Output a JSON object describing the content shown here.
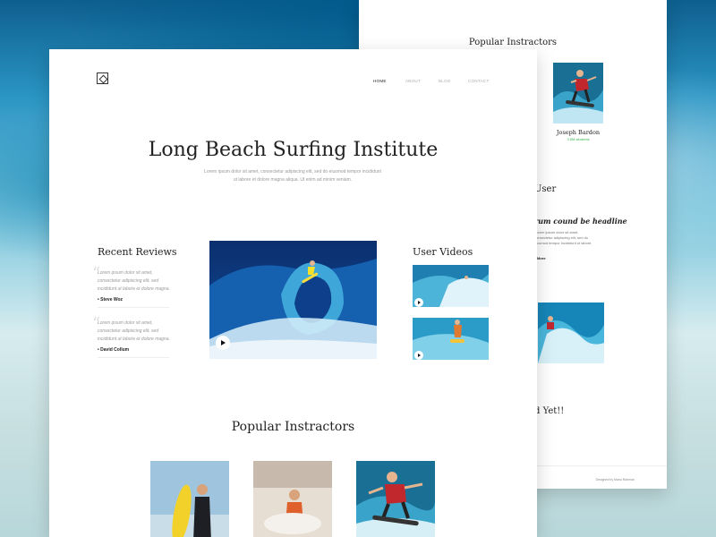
{
  "back": {
    "section_title": "Popular Instractors",
    "instructor_name": "Joseph Bardon",
    "instructor_sub": "3.5M students",
    "heading_fragment": "User",
    "headline_fragment": "rum cound be headline",
    "paragraph": "Lorem ipsum dolor sit amet, consectetur adipiscing elit, sed do eiusmod tempor incididunt ut labore.",
    "more_label": "More",
    "heading3_fragment": "d Yet!!",
    "footer": "Designed by Manu Rahman"
  },
  "logo": {
    "icon": "diamond-logo-icon"
  },
  "nav": {
    "home": "HOME",
    "about": "ABOUT",
    "blog": "BLOG",
    "contact": "CONTACT"
  },
  "hero": {
    "title": "Long Beach Surfing Institute",
    "subtitle": "Lorem ipsum dolor sit amet, consectetur adipiscing elit, sed do eiusmod tempor incididunt ut labore et dolore magna aliqua. Ut enim ad minim veniam."
  },
  "reviews": {
    "title": "Recent Reviews",
    "items": [
      {
        "text": "Lorem ipsum dolor sit amet, consectetur adipiscing elit, sed incididunt ut labore et dolore magna.",
        "author": "Steve Woz"
      },
      {
        "text": "Lorem ipsum dolor sit amet, consectetur adipiscing elit, sed incididunt ut labore et dolore magna.",
        "author": "David Collum"
      }
    ]
  },
  "user_videos": {
    "title": "User Videos"
  },
  "instructors": {
    "title": "Popular Instractors"
  },
  "colors": {
    "accent_green": "#2fb84a",
    "text": "#222222",
    "muted": "#999999"
  }
}
